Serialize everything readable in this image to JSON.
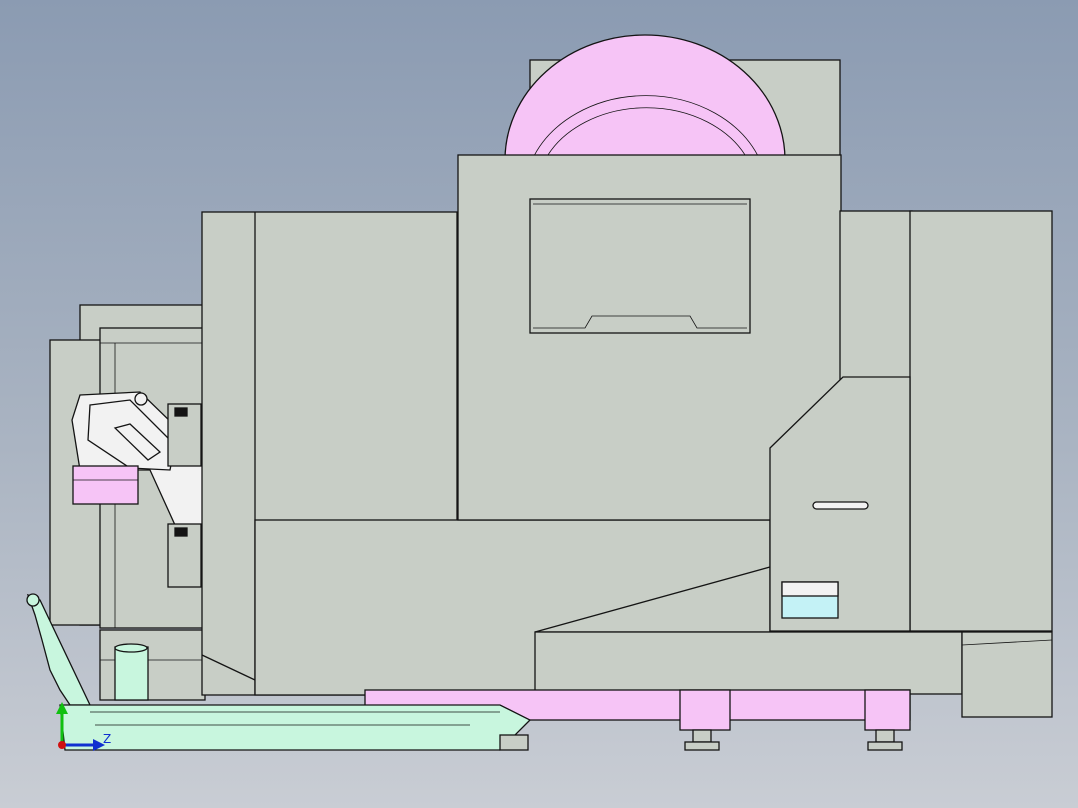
{
  "colors": {
    "background_top": "#8b9bb2",
    "background_bottom": "#c9cdd4",
    "enclosure_gray": "#c8cec6",
    "pink_parts": "#f6c4f6",
    "mint_parts": "#c8f6de",
    "cyan_parts": "#c4f2f6",
    "white_parts": "#f2f2f2",
    "outline": "#141414",
    "axis_y": "#10c010",
    "axis_z": "#1030d0",
    "axis_x": "#d01010"
  },
  "triad": {
    "z_label": "Z",
    "icons": [
      "axis-y-arrow-icon",
      "axis-z-arrow-icon",
      "axis-x-origin-icon"
    ]
  }
}
